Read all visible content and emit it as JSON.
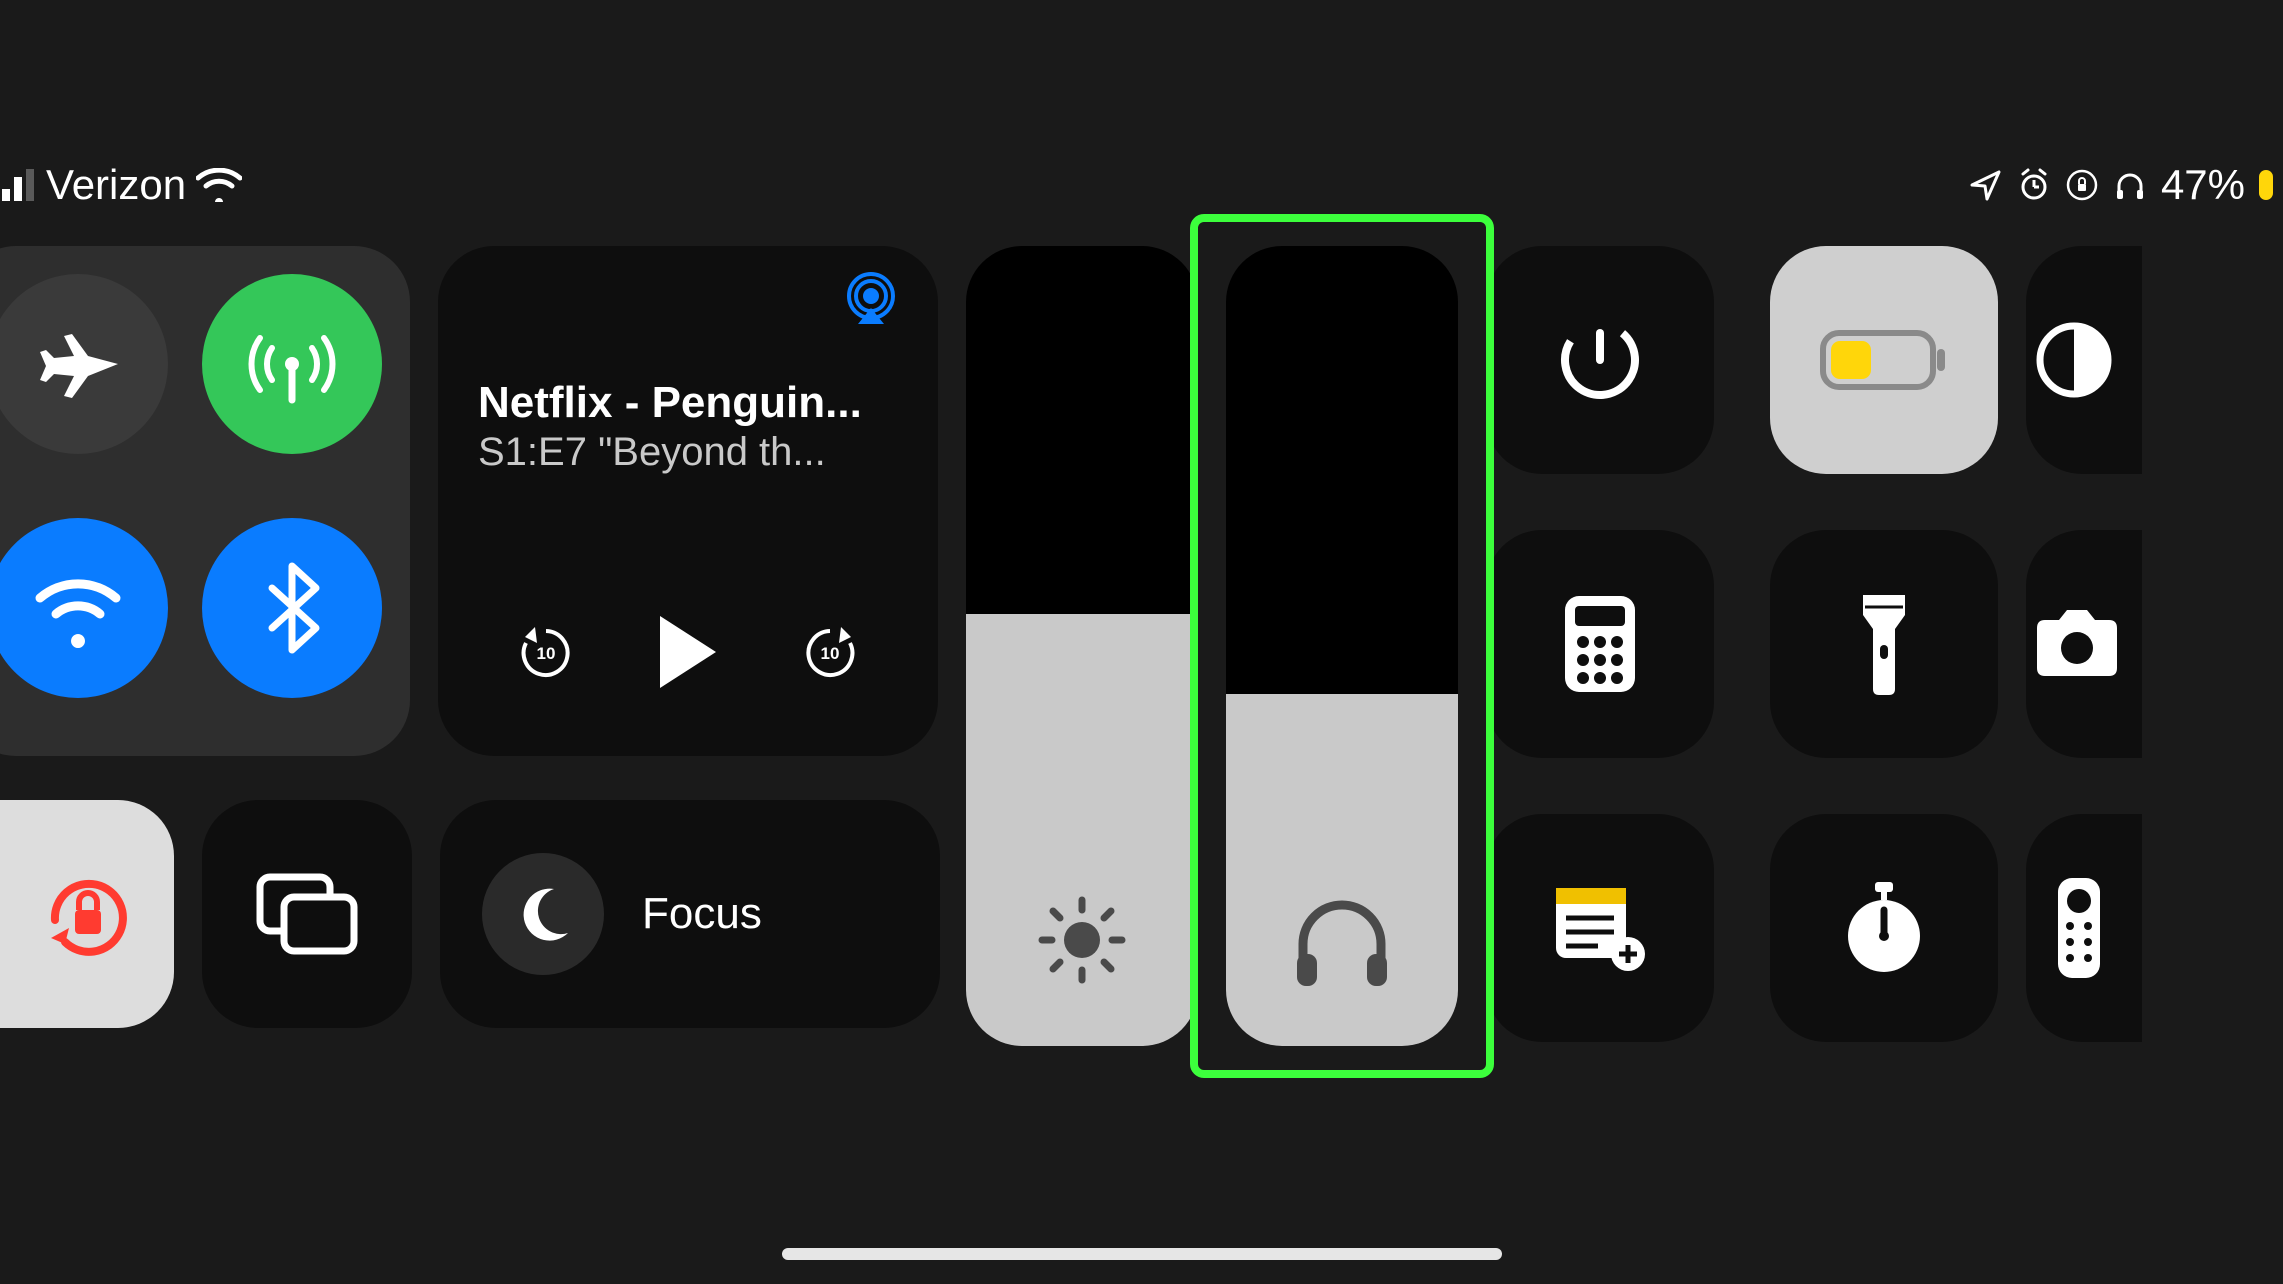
{
  "status": {
    "carrier": "Verizon",
    "battery_pct": "47%"
  },
  "connectivity": {
    "airplane": {
      "on": false
    },
    "cellular": {
      "on": true
    },
    "wifi": {
      "on": true
    },
    "bluetooth": {
      "on": true
    }
  },
  "media": {
    "title": "Netflix - Penguin...",
    "subtitle": "S1:E7 \"Beyond th...",
    "rewind_seconds": "10",
    "forward_seconds": "10"
  },
  "sliders": {
    "brightness_pct": 54,
    "volume_pct": 44
  },
  "focus": {
    "label": "Focus"
  },
  "small_tiles": {
    "timer": "timer",
    "low_power": "low-power",
    "calculator": "calculator",
    "flashlight": "flashlight",
    "notes": "notes",
    "stopwatch": "stopwatch",
    "dark_mode": "dark-mode",
    "camera": "camera",
    "remote": "remote"
  },
  "highlight_target": "volume-slider"
}
